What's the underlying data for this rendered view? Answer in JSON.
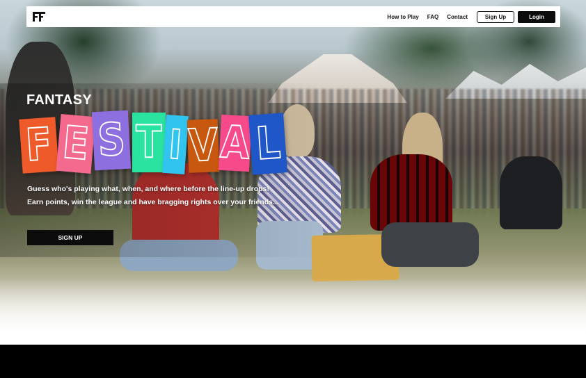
{
  "nav": {
    "logo_text": "FF",
    "links": [
      "How to Play",
      "FAQ",
      "Contact"
    ],
    "signup_label": "Sign Up",
    "login_label": "Login"
  },
  "hero": {
    "pretitle": "FANTASY",
    "title_letters": [
      "F",
      "E",
      "S",
      "T",
      "I",
      "V",
      "A",
      "L"
    ],
    "flag_colors": [
      "#ef5a2a",
      "#f46a8e",
      "#8e6fe0",
      "#2be3a0",
      "#31c4ef",
      "#c8580f",
      "#f64a8a",
      "#1f56c8"
    ],
    "tagline_line1": "Guess who's playing what, when, and where before the line-up drops!",
    "tagline_line2": "Earn points, win the league and have bragging rights over your friends...",
    "cta_label": "SIGN UP"
  },
  "icons": {
    "logo": "ff-logo-icon"
  }
}
